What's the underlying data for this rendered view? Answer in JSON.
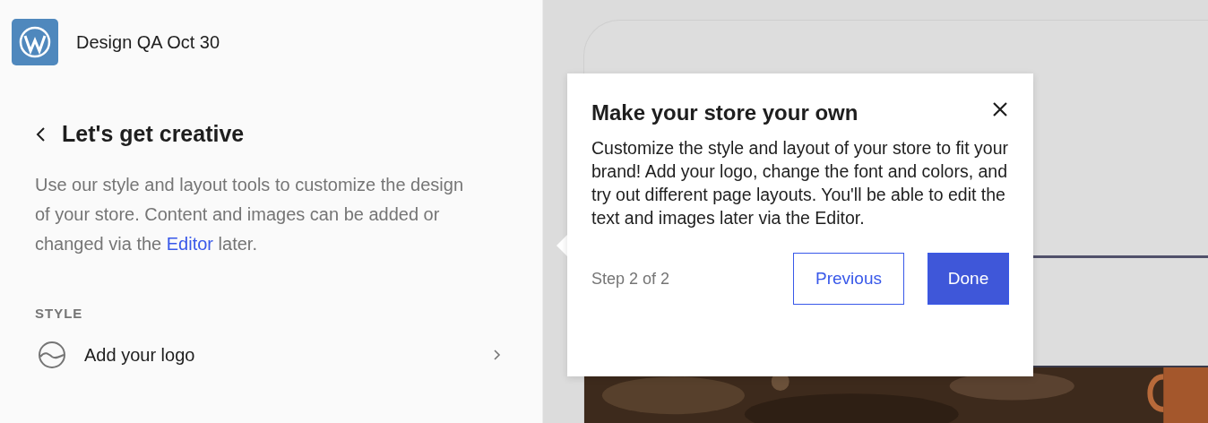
{
  "site": {
    "title": "Design QA Oct 30"
  },
  "panel": {
    "heading": "Let's get creative",
    "description_before": "Use our style and layout tools to customize the design of your store. Content and images can be added or changed via the ",
    "description_link": "Editor",
    "description_after": " later.",
    "section_label": "STYLE",
    "items": [
      {
        "label": "Add your logo"
      }
    ]
  },
  "tour": {
    "title": "Make your store your own",
    "body": "Customize the style and layout of your store to fit your brand! Add your logo, change the font and colors, and try out different page layouts. You'll be able to edit the text and images later via the Editor.",
    "step": "Step 2 of 2",
    "buttons": [
      {
        "label": "Previous",
        "kind": "secondary"
      },
      {
        "label": "Done",
        "kind": "primary"
      }
    ]
  }
}
